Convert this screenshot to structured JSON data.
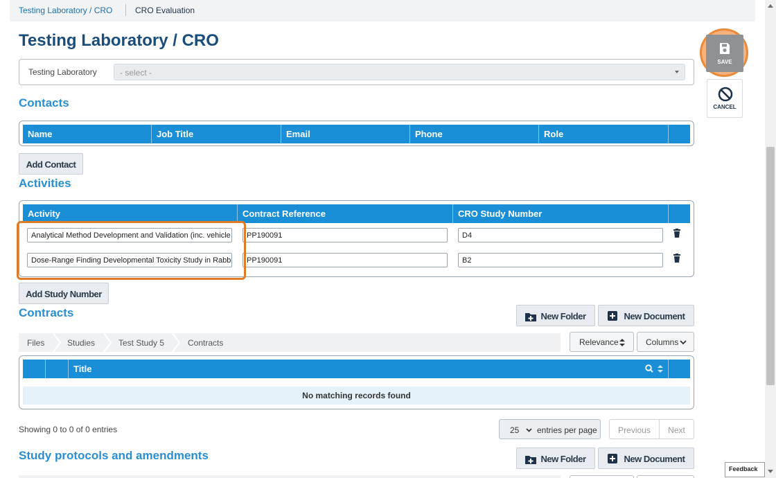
{
  "breadcrumb": {
    "parent": "Testing Laboratory / CRO",
    "current": "CRO Evaluation"
  },
  "page_title": "Testing Laboratory / CRO",
  "lab_field": {
    "label": "Testing Laboratory",
    "placeholder": "- select -"
  },
  "actions": {
    "save_label": "SAVE",
    "cancel_label": "CANCEL"
  },
  "contacts": {
    "title": "Contacts",
    "columns": [
      "Name",
      "Job Title",
      "Email",
      "Phone",
      "Role"
    ],
    "add_label": "Add Contact"
  },
  "activities": {
    "title": "Activities",
    "columns": [
      "Activity",
      "Contract Reference",
      "CRO Study Number"
    ],
    "rows": [
      {
        "activity": "Analytical Method Development and Validation (inc. vehicle",
        "contract_ref": "PP190091",
        "study_number": "D4"
      },
      {
        "activity": "Dose-Range Finding Developmental Toxicity Study in Rabbits",
        "contract_ref": "PP190091",
        "study_number": "B2"
      }
    ],
    "add_label": "Add Study Number"
  },
  "contracts": {
    "title": "Contracts",
    "new_folder_label": "New Folder",
    "new_document_label": "New Document",
    "path": [
      "Files",
      "Studies",
      "Test Study 5",
      "Contracts"
    ],
    "sort_label": "Relevance",
    "columns_label": "Columns",
    "table_title_col": "Title",
    "empty_text": "No matching records found",
    "showing_text": "Showing 0 to 0 of 0 entries",
    "page_size": "25",
    "page_size_suffix": "entries per page",
    "prev_label": "Previous",
    "next_label": "Next"
  },
  "protocols": {
    "title": "Study protocols and amendments",
    "new_folder_label": "New Folder",
    "new_document_label": "New Document"
  },
  "feedback_label": "Feedback",
  "colors": {
    "header_blue": "#1a8fd8",
    "title_blue": "#1a4d7a",
    "section_blue": "#2a8ed0",
    "highlight_orange": "#e07b26"
  }
}
